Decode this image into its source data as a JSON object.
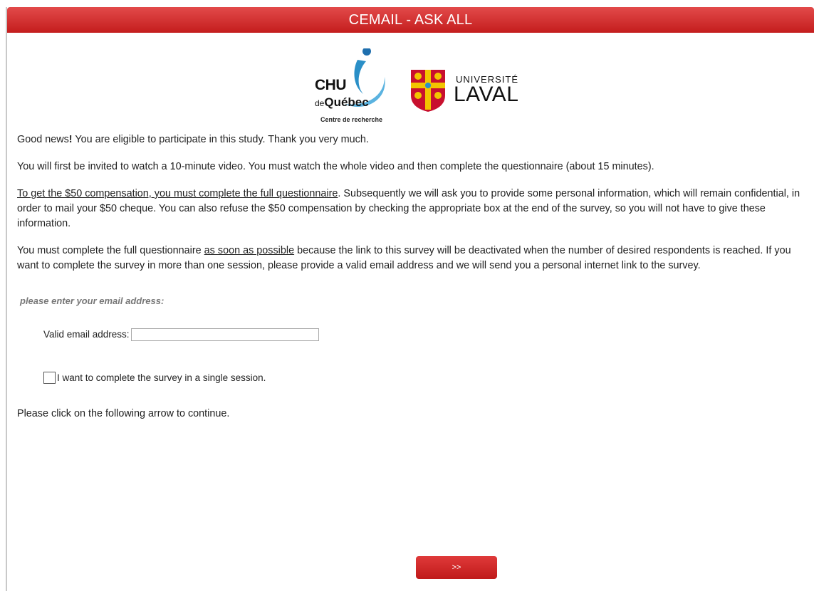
{
  "header": {
    "title": "CEMAIL - ASK ALL",
    "color": "#d32a2a"
  },
  "logos": {
    "chu": {
      "line1": "CHU",
      "line2_prefix": "de",
      "line2_name": "Québec",
      "tagline": "Centre de recherche",
      "accent": "#2a8fc7"
    },
    "laval": {
      "top": "UNIVERSITÉ",
      "name": "LAVAL",
      "shield_colors": [
        "#c8102e",
        "#f2c500"
      ]
    }
  },
  "intro": {
    "p1_lead": "Good news",
    "p1_bang": "!",
    "p1_rest": " You are eligible to participate in this study. Thank you very much.",
    "p2": "You will first be invited to watch a 10-minute video. You must watch the whole video and then complete the questionnaire (about 15 minutes).",
    "p3_underlined": "To get the $50 compensation, you must complete the full questionnaire",
    "p3_rest": ". Subsequently we will ask you to provide some personal information, which will remain confidential, in order to mail your $50 cheque. You can also refuse the $50 compensation by checking the appropriate box at the end of the survey, so you will not have to give these information.",
    "p4_start": "You must complete the full questionnaire ",
    "p4_underlined": "as soon as possible",
    "p4_rest": " because the link to this survey will be deactivated when the number of desired respondents is reached. If you want to complete the survey in more than one session, please provide a valid email address and we will send you a personal internet link to the survey."
  },
  "form": {
    "prompt": "please enter your email address:",
    "email_label": "Valid email address:",
    "email_value": "",
    "single_session_label": "I want to complete the survey in a single session.",
    "single_session_checked": false
  },
  "footer": {
    "continue_text": "Please click on the following arrow to continue.",
    "next_label": ">>"
  }
}
